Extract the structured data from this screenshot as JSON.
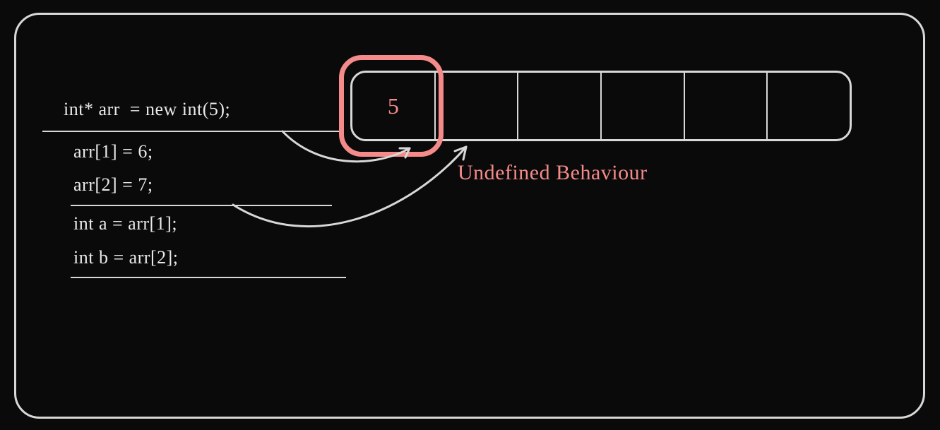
{
  "code": {
    "line1": "int* arr  = new int(5);",
    "line2": "arr[1] = 6;",
    "line3": "arr[2] = 7;",
    "line4": "int a = arr[1];",
    "line5": "int b = arr[2];"
  },
  "memory": {
    "cell0": "5",
    "cell1": "",
    "cell2": "",
    "cell3": "",
    "cell4": "",
    "cell5": ""
  },
  "annotation": {
    "undefined_behaviour": "Undefined Behaviour"
  }
}
